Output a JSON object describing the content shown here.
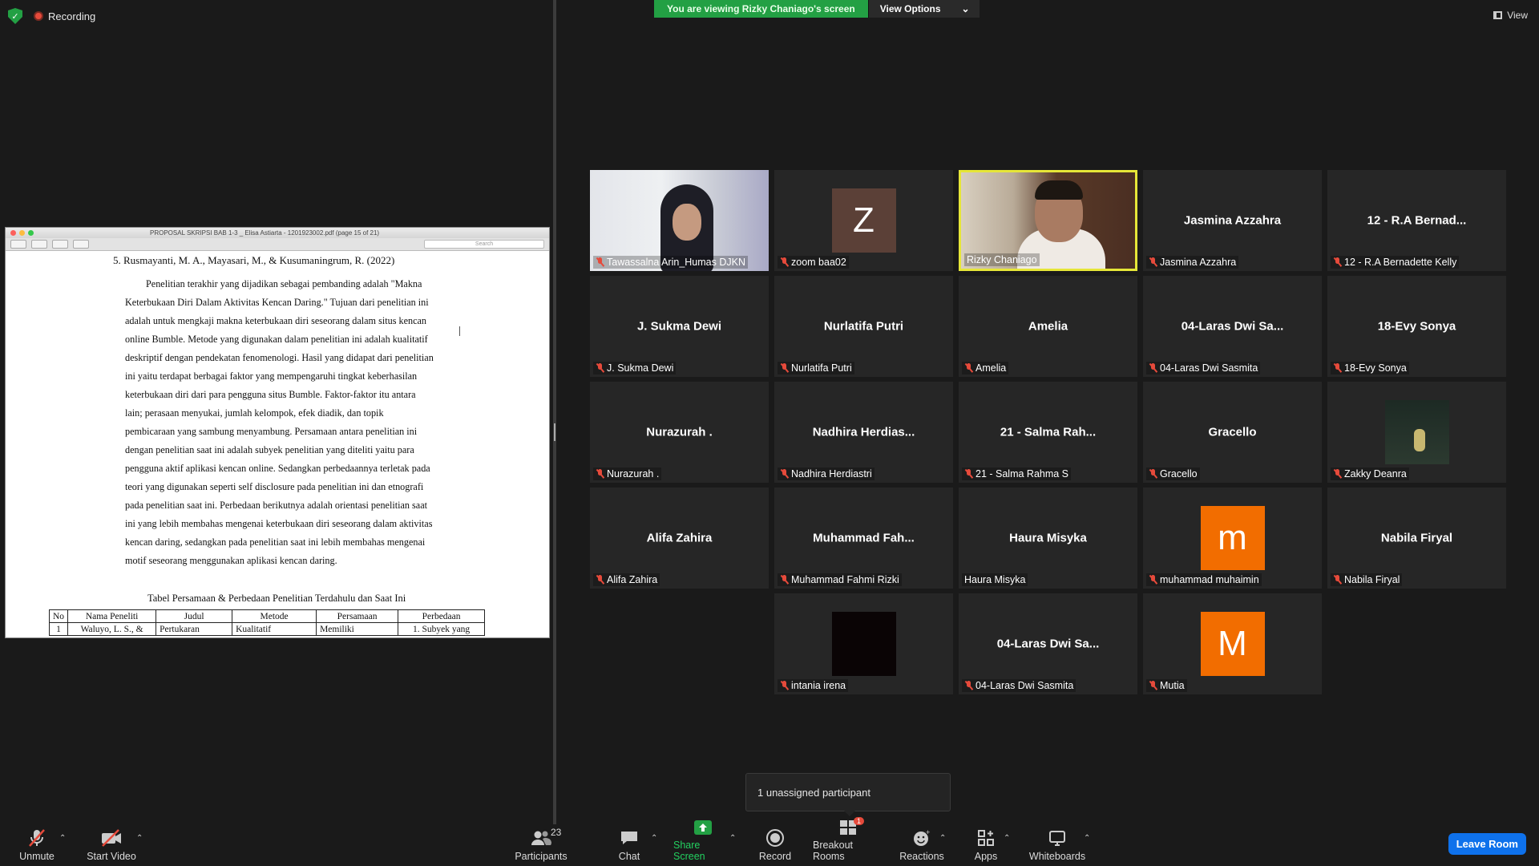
{
  "top": {
    "recording_label": "Recording",
    "viewing_banner": "You are viewing Rizky Chaniago's screen",
    "view_options_label": "View Options",
    "view_label": "View"
  },
  "shared_doc": {
    "window_title": "PROPOSAL SKRIPSI BAB 1-3 _ Elisa Astiarta - 1201923002.pdf (page 15 of 21)",
    "search_placeholder": "Search",
    "reference": "5. Rusmayanti, M. A., Mayasari, M., & Kusumaningrum, R. (2022)",
    "paragraph_lines": [
      "Penelitian terakhir yang dijadikan sebagai pembanding adalah \"Makna",
      "Keterbukaan Diri Dalam Aktivitas Kencan Daring.\" Tujuan dari penelitian ini",
      "adalah untuk mengkaji makna keterbukaan diri seseorang dalam situs kencan",
      "online Bumble. Metode yang digunakan dalam penelitian ini adalah kualitatif",
      "deskriptif dengan pendekatan fenomenologi. Hasil yang didapat dari penelitian",
      "ini yaitu terdapat berbagai faktor yang mempengaruhi tingkat keberhasilan",
      "keterbukaan diri dari para pengguna situs Bumble. Faktor-faktor itu antara",
      "lain; perasaan menyukai, jumlah kelompok, efek diadik, dan topik",
      "pembicaraan yang sambung menyambung. Persamaan antara penelitian ini",
      "dengan penelitian saat ini adalah subyek penelitian yang diteliti yaitu para",
      "pengguna aktif aplikasi kencan online. Sedangkan perbedaannya terletak pada",
      "teori yang digunakan seperti self disclosure pada penelitian ini dan etnografi",
      "pada penelitian saat ini. Perbedaan berikutnya adalah orientasi penelitian saat",
      "ini yang lebih membahas mengenai keterbukaan diri seseorang dalam aktivitas",
      "kencan daring, sedangkan pada penelitian saat ini lebih membahas mengenai",
      "motif seseorang menggunakan aplikasi kencan daring."
    ],
    "table_caption": "Tabel Persamaan & Perbedaan Penelitian Terdahulu dan Saat Ini",
    "table_headers": [
      "No",
      "Nama Peneliti",
      "Judul",
      "Metode",
      "Persamaan",
      "Perbedaan"
    ],
    "table_row": [
      "1",
      "Waluyo, L. S., &",
      "Pertukaran",
      "Kualitatif",
      "Memiliki",
      "1. Subyek yang"
    ]
  },
  "participants": [
    {
      "big": "",
      "name": "Tawassalna Arin_Humas DJKN",
      "kind": "photo-arin",
      "muted": true
    },
    {
      "big": "Z",
      "name": "zoom baa02",
      "kind": "avatar",
      "color": "#5b4037",
      "muted": true
    },
    {
      "big": "",
      "name": "Rizky Chaniago",
      "kind": "photo-rizky",
      "muted": false,
      "active": true
    },
    {
      "big": "Jasmina Azzahra",
      "name": "Jasmina Azzahra",
      "kind": "text",
      "muted": true
    },
    {
      "big": "12 - R.A Bernad...",
      "name": "12 - R.A Bernadette Kelly",
      "kind": "text",
      "muted": true
    },
    {
      "big": "J. Sukma Dewi",
      "name": "J. Sukma Dewi",
      "kind": "text",
      "muted": true
    },
    {
      "big": "Nurlatifa Putri",
      "name": "Nurlatifa Putri",
      "kind": "text",
      "muted": true
    },
    {
      "big": "Amelia",
      "name": "Amelia",
      "kind": "text",
      "muted": true
    },
    {
      "big": "04-Laras Dwi Sa...",
      "name": "04-Laras Dwi Sasmita",
      "kind": "text",
      "muted": true
    },
    {
      "big": "18-Evy Sonya",
      "name": "18-Evy Sonya",
      "kind": "text",
      "muted": true
    },
    {
      "big": "Nurazurah .",
      "name": "Nurazurah .",
      "kind": "text",
      "muted": true
    },
    {
      "big": "Nadhira Herdias...",
      "name": "Nadhira Herdiastri",
      "kind": "text",
      "muted": true
    },
    {
      "big": "21 - Salma Rah...",
      "name": "21 - Salma Rahma S",
      "kind": "text",
      "muted": true
    },
    {
      "big": "Gracello",
      "name": "Gracello",
      "kind": "text",
      "muted": true
    },
    {
      "big": "",
      "name": "Zakky Deanra",
      "kind": "photo-zakky",
      "muted": true
    },
    {
      "big": "Alifa Zahira",
      "name": "Alifa Zahira",
      "kind": "text",
      "muted": true
    },
    {
      "big": "Muhammad Fah...",
      "name": "Muhammad Fahmi Rizki",
      "kind": "text",
      "muted": true
    },
    {
      "big": "Haura Misyka",
      "name": "Haura Misyka",
      "kind": "text",
      "muted": false
    },
    {
      "big": "m",
      "name": "muhammad muhaimin",
      "kind": "avatar",
      "color": "#f26d00",
      "muted": true
    },
    {
      "big": "Nabila Firyal",
      "name": "Nabila Firyal",
      "kind": "text",
      "muted": true
    },
    {
      "big": "",
      "name": "intania irena",
      "kind": "avatar",
      "color": "#0a0405",
      "muted": true
    },
    {
      "big": "04-Laras Dwi Sa...",
      "name": "04-Laras Dwi Sasmita",
      "kind": "text",
      "muted": true
    },
    {
      "big": "M",
      "name": "Mutia",
      "kind": "avatar",
      "color": "#f26d00",
      "muted": true
    }
  ],
  "popup": {
    "text": "1 unassigned participant"
  },
  "toolbar": {
    "unmute": "Unmute",
    "start_video": "Start Video",
    "participants": "Participants",
    "participant_count": "23",
    "chat": "Chat",
    "share_screen": "Share Screen",
    "record": "Record",
    "breakout_rooms": "Breakout Rooms",
    "breakout_badge": "1",
    "reactions": "Reactions",
    "apps": "Apps",
    "whiteboards": "Whiteboards",
    "leave_room": "Leave Room"
  }
}
